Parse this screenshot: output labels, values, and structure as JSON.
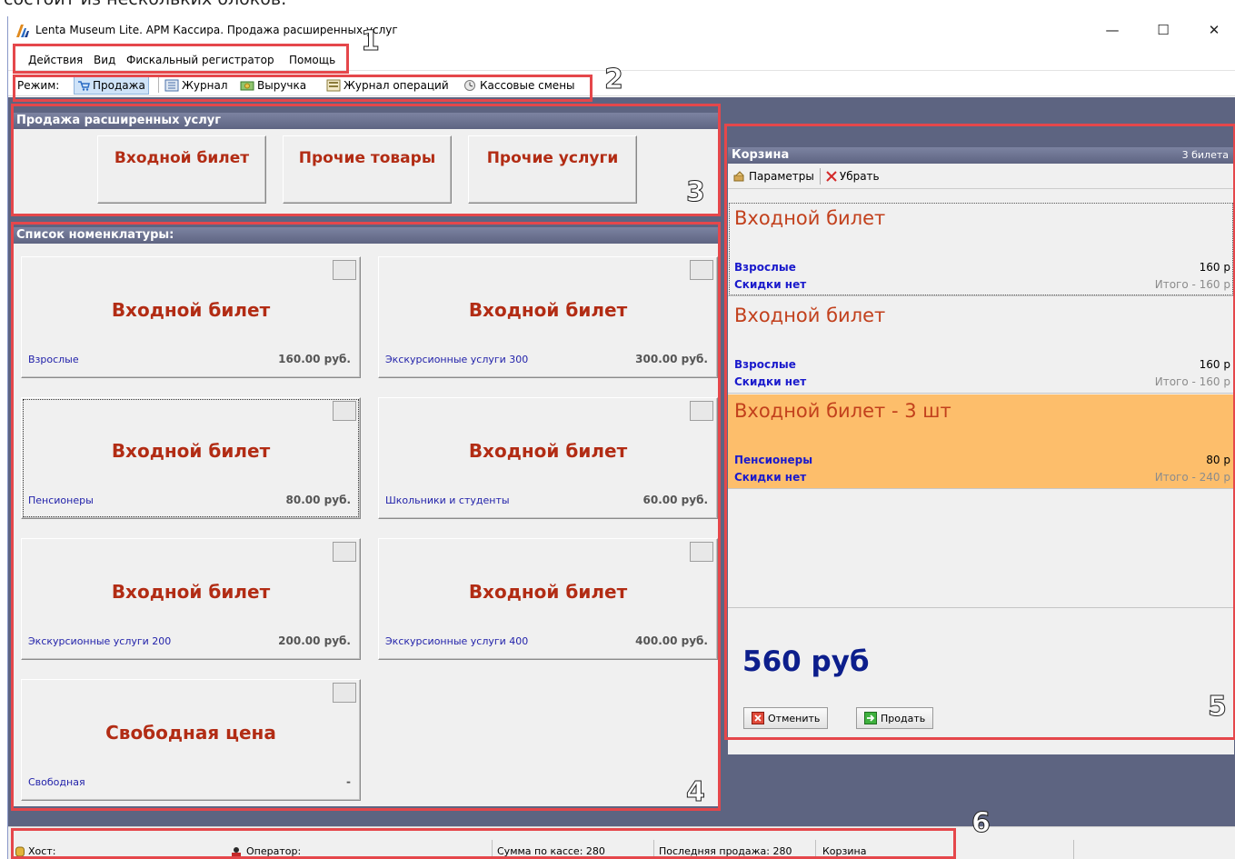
{
  "caption_fragment": "состоит из нескольких блоков:",
  "window": {
    "title": "Lenta Museum Lite. АРМ Кассира. Продажа расширенных услуг",
    "minimize": "—",
    "maximize": "☐",
    "close": "✕"
  },
  "menu": {
    "actions": "Действия",
    "view": "Вид",
    "fiscal": "Фискальный регистратор",
    "help": "Помощь"
  },
  "toolbar": {
    "mode_label": "Режим:",
    "sale": "Продажа",
    "journal": "Журнал",
    "revenue": "Выручка",
    "ops_journal": "Журнал операций",
    "shifts": "Кассовые смены"
  },
  "services": {
    "header": "Продажа расширенных услуг",
    "buttons": [
      "Входной билет",
      "Прочие товары",
      "Прочие услуги"
    ]
  },
  "nomenclature": {
    "header": "Список номенклатуры:",
    "items": [
      {
        "name": "Входной билет",
        "category": "Взрослые",
        "price": "160.00 руб."
      },
      {
        "name": "Входной билет",
        "category": "Экскурсионные услуги 300",
        "price": "300.00 руб."
      },
      {
        "name": "Входной билет",
        "category": "Пенсионеры",
        "price": "80.00 руб."
      },
      {
        "name": "Входной билет",
        "category": "Школьники и студенты",
        "price": "60.00 руб."
      },
      {
        "name": "Входной билет",
        "category": "Экскурсионные услуги 200",
        "price": "200.00 руб."
      },
      {
        "name": "Входной билет",
        "category": "Экскурсионные услуги 400",
        "price": "400.00 руб."
      },
      {
        "name": "Свободная цена",
        "category": "Свободная",
        "price": "-"
      }
    ]
  },
  "cart": {
    "header": "Корзина",
    "count": "3 билета",
    "params": "Параметры",
    "remove": "Убрать",
    "items": [
      {
        "name": "Входной билет",
        "category": "Взрослые",
        "price": "160 р",
        "discount": "Скидки нет",
        "total": "Итого - 160 р"
      },
      {
        "name": "Входной билет",
        "category": "Взрослые",
        "price": "160 р",
        "discount": "Скидки нет",
        "total": "Итого - 160 р"
      },
      {
        "name": "Входной билет - 3 шт",
        "category": "Пенсионеры",
        "price": "80 р",
        "discount": "Скидки нет",
        "total": "Итого - 240 р"
      }
    ],
    "sum": "560 руб",
    "cancel": "Отменить",
    "sell": "Продать"
  },
  "status": {
    "host": "Хост:",
    "operator": "Оператор:",
    "cash_sum": "Сумма по кассе: 280",
    "last_sale": "Последняя продажа: 280",
    "cart": "Корзина"
  },
  "annotations": [
    "1",
    "2",
    "3",
    "4",
    "5",
    "6"
  ],
  "colors": {
    "accent_red": "#b22c14",
    "highlight_orange": "#fdbe6b",
    "link_blue": "#1a1acc",
    "panel_header": "#5d6481",
    "annotation_box": "#e5474b"
  }
}
